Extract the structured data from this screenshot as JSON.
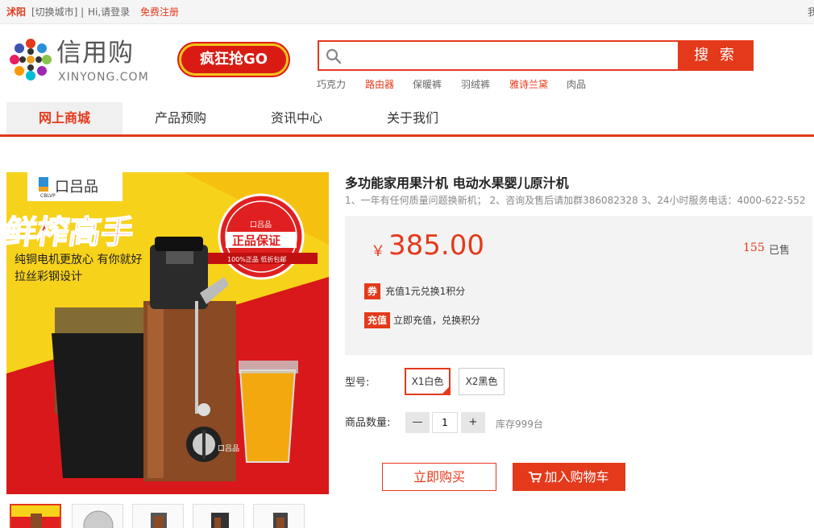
{
  "topbar": {
    "city": "沭阳",
    "switch_city": "[切换城市] |",
    "greeting": "Hi,请登录",
    "register": "免费注册",
    "right_cut": "我"
  },
  "header": {
    "logo_text": "信用购",
    "logo_sub": "XINYONG.COM",
    "badge": "疯狂抢GO",
    "search_placeholder": "",
    "search_button": "搜 索",
    "hot_words": [
      "巧克力",
      "路由器",
      "保暖裤",
      "羽绒裤",
      "雅诗兰黛",
      "肉品"
    ],
    "hot_highlight": [
      false,
      true,
      false,
      false,
      true,
      false
    ]
  },
  "nav": {
    "items": [
      "网上商城",
      "产品预购",
      "资讯中心",
      "关于我们"
    ],
    "active_index": 0
  },
  "product": {
    "image": {
      "brand": "口吕品",
      "brand_sub": "CBLVP",
      "headline": "鲜榨高手",
      "line1": "纯铜电机更放心  有你就好",
      "line2": "拉丝彩钢设计",
      "seal_top": "口吕品",
      "seal_main": "正品保证",
      "seal_bottom": "100%正品  低折包邮",
      "device_brand": "口吕品"
    },
    "thumbnails": 5,
    "title": "多功能家用果汁机 电动水果婴儿原汁机",
    "subtitle": "1、一年有任何质量问题换新机； 2、咨询及售后请加群386082328 3、24小时服务电话：4000-622-552",
    "currency": "￥",
    "price": "385.00",
    "sold_count": "155",
    "sold_label": "已售",
    "coupon_tag": "券",
    "coupon_text": "充值1元兑换1积分",
    "recharge_tag": "充值",
    "recharge_text": "立即充值，兑换积分",
    "model_label": "型号:",
    "models": [
      "X1白色",
      "X2黑色"
    ],
    "selected_model": 0,
    "qty_label": "商品数量:",
    "qty_minus": "—",
    "qty_value": "1",
    "qty_plus": "+",
    "stock": "库存999台",
    "buy_now": "立即购买",
    "add_cart": "加入购物车"
  },
  "colors": {
    "accent": "#e4391b",
    "price_bg": "#f3f3f3",
    "banner_yellow": "#f7d21a",
    "banner_red": "#e02020"
  }
}
